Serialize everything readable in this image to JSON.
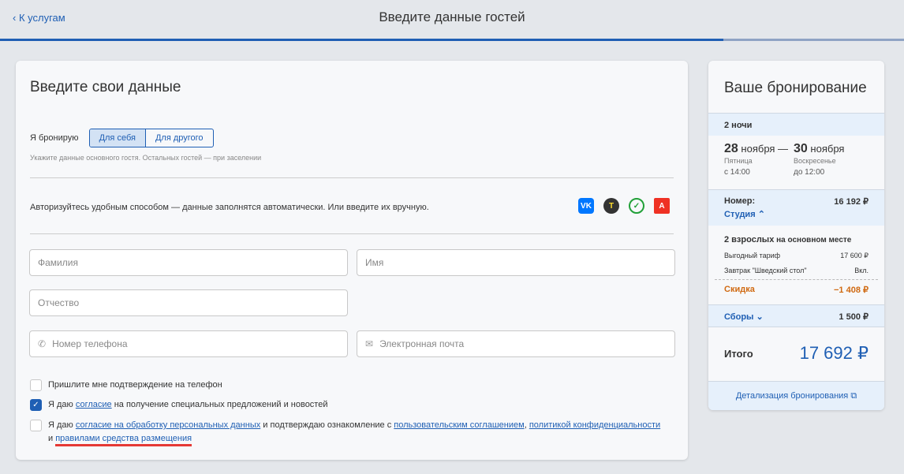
{
  "header": {
    "back": "К услугам",
    "title": "Введите данные гостей",
    "progress_percent": 80,
    "colors": {
      "accent": "#1f5fb4"
    }
  },
  "form": {
    "title": "Введите свои данные",
    "booking_for_label": "Я бронирую",
    "options": [
      "Для себя",
      "Для другого"
    ],
    "selected": "Для себя",
    "hint": "Укажите данные основного гостя. Остальных гостей — при заселении",
    "auth_text": "Авторизуйтесь удобным способом — данные заполнятся автоматически. Или введите их вручную.",
    "auth_icons": [
      "vk-icon",
      "tinkoff-icon",
      "sber-icon",
      "alfa-icon"
    ],
    "fields": {
      "last_name": "Фамилия",
      "first_name": "Имя",
      "middle_name": "Отчество",
      "phone": "Номер телефона",
      "email": "Электронная почта"
    },
    "checks": [
      {
        "checked": false,
        "text": "Пришлите мне подтверждение на телефон"
      },
      {
        "checked": true,
        "pre": "Я даю ",
        "link": "согласие",
        "post": " на получение специальных предложений и новостей"
      },
      {
        "checked": false,
        "pre": "Я даю ",
        "link1": "согласие на обработку персональных данных",
        "mid": " и подтверждаю ознакомление с ",
        "link2": "пользовательским соглашением",
        "comma": ", ",
        "link3": "политикой конфиденциальности",
        "and": "и ",
        "link4": "правилами средства размещения"
      }
    ]
  },
  "summary": {
    "title": "Ваше бронирование",
    "nights": "2 ночи",
    "checkin": {
      "day": "28",
      "month": "ноября",
      "weekday": "Пятница",
      "time": "с 14:00"
    },
    "dash": "—",
    "checkout": {
      "day": "30",
      "month": "ноября",
      "weekday": "Воскресенье",
      "time": "до 12:00"
    },
    "room_label": "Номер:",
    "room_price": "16 192 ₽",
    "room_type": "Студия",
    "guests_bold": "2 взрослых",
    "guests_rest": " на основном месте",
    "tariff": "Выгодный тариф",
    "tariff_price": "17 600 ₽",
    "breakfast": "Завтрак \"Шведский стол\"",
    "breakfast_value": "Вкл.",
    "discount": "Скидка",
    "discount_value": "−1 408 ₽",
    "fees": "Сборы",
    "fees_value": "1 500 ₽",
    "total_label": "Итого",
    "total": "17 692 ₽",
    "details_link": "Детализация бронирования"
  }
}
